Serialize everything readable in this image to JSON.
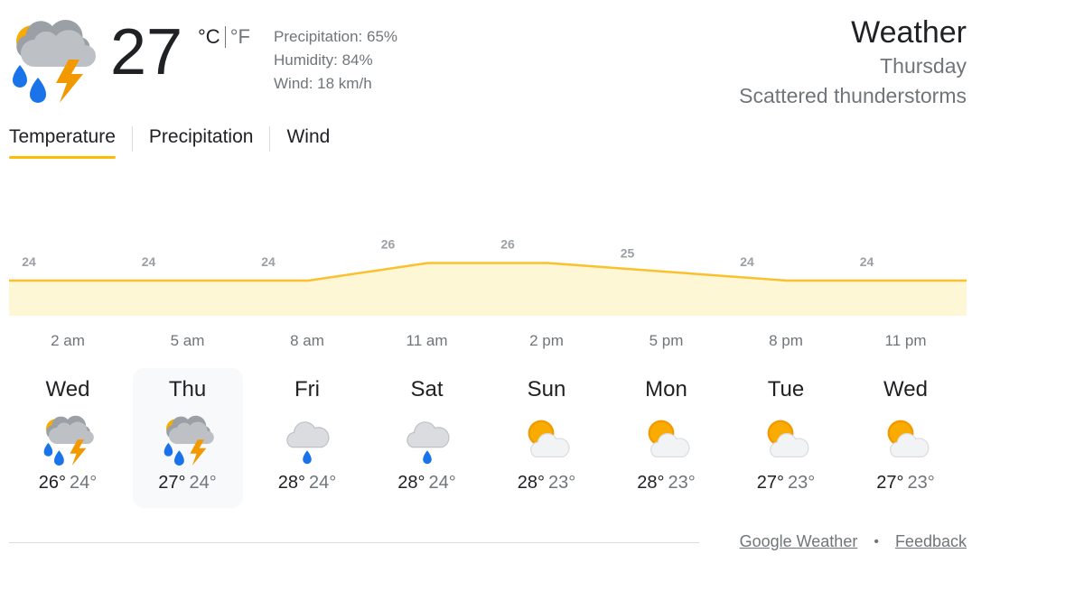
{
  "current": {
    "temp": "27",
    "unit_c": "°C",
    "unit_f": "°F",
    "precipitation": "Precipitation: 65%",
    "humidity": "Humidity: 84%",
    "wind": "Wind: 18 km/h",
    "icon": "thunderstorm-icon"
  },
  "header": {
    "title": "Weather",
    "day": "Thursday",
    "condition": "Scattered thunderstorms"
  },
  "tabs": [
    {
      "label": "Temperature",
      "active": true
    },
    {
      "label": "Precipitation",
      "active": false
    },
    {
      "label": "Wind",
      "active": false
    }
  ],
  "chart_data": {
    "type": "area",
    "x": [
      "2 am",
      "5 am",
      "8 am",
      "11 am",
      "2 pm",
      "5 pm",
      "8 pm",
      "11 pm"
    ],
    "values": [
      24,
      24,
      24,
      26,
      26,
      25,
      24,
      24
    ],
    "ylim": [
      20,
      28
    ],
    "colors": {
      "line": "#fbc02d",
      "fill": "#fef7d6",
      "label": "#9aa0a6"
    }
  },
  "days": [
    {
      "name": "Wed",
      "hi": "26°",
      "lo": "24°",
      "icon": "thunderstorm-icon",
      "selected": false
    },
    {
      "name": "Thu",
      "hi": "27°",
      "lo": "24°",
      "icon": "thunderstorm-icon",
      "selected": true
    },
    {
      "name": "Fri",
      "hi": "28°",
      "lo": "24°",
      "icon": "rain-cloud-icon",
      "selected": false
    },
    {
      "name": "Sat",
      "hi": "28°",
      "lo": "24°",
      "icon": "rain-cloud-icon",
      "selected": false
    },
    {
      "name": "Sun",
      "hi": "28°",
      "lo": "23°",
      "icon": "partly-cloudy-icon",
      "selected": false
    },
    {
      "name": "Mon",
      "hi": "28°",
      "lo": "23°",
      "icon": "partly-cloudy-icon",
      "selected": false
    },
    {
      "name": "Tue",
      "hi": "27°",
      "lo": "23°",
      "icon": "partly-cloudy-icon",
      "selected": false
    },
    {
      "name": "Wed",
      "hi": "27°",
      "lo": "23°",
      "icon": "partly-cloudy-icon",
      "selected": false
    }
  ],
  "footer": {
    "link1": "Google Weather",
    "separator": "•",
    "link2": "Feedback"
  }
}
